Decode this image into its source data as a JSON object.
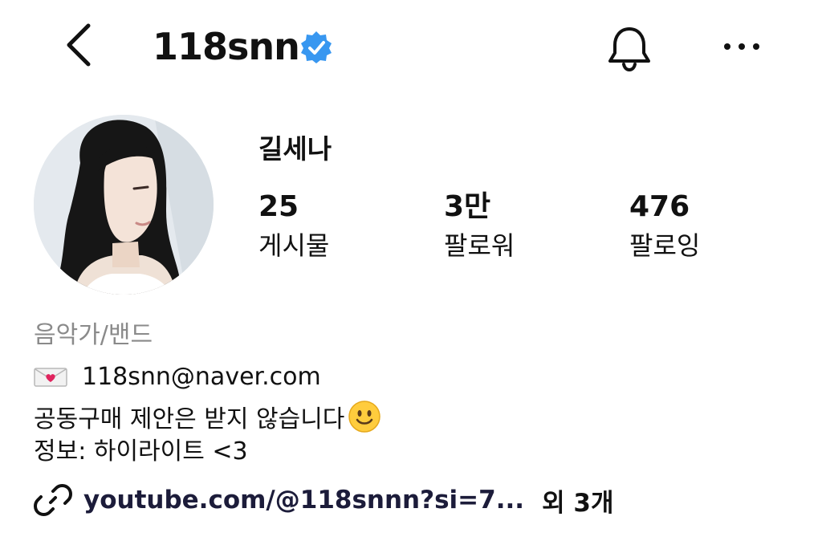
{
  "header": {
    "username": "118snn",
    "back_icon": "chevron-left-icon",
    "verified_icon": "verified-badge-icon",
    "bell_icon": "bell-icon",
    "more_icon": "more-horizontal-icon"
  },
  "profile": {
    "display_name": "길세나",
    "stats": [
      {
        "value": "25",
        "label": "게시물"
      },
      {
        "value": "3만",
        "label": "팔로워"
      },
      {
        "value": "476",
        "label": "팔로잉"
      }
    ]
  },
  "bio": {
    "category": "음악가/밴드",
    "email": "118snn@naver.com",
    "line3": "공동구매 제안은 받지 않습니다",
    "line4": "정보: 하이라이트 <3"
  },
  "link": {
    "url": "youtube.com/@118snnn?si=7...",
    "extra": "외 3개"
  },
  "colors": {
    "verified": "#3897f0",
    "category_text": "#8a8a8a"
  }
}
